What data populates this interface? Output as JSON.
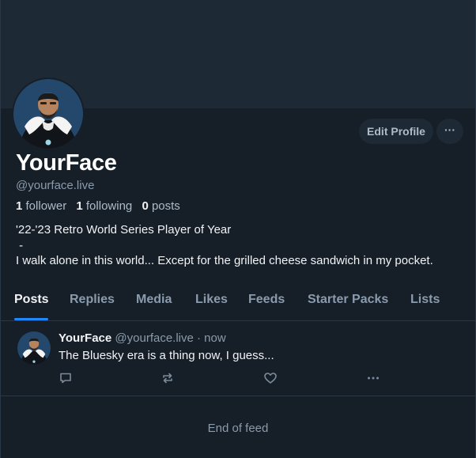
{
  "profile": {
    "display_name": "YourFace",
    "handle": "@yourface.live",
    "followers_count": "1",
    "followers_label": "follower",
    "following_count": "1",
    "following_label": "following",
    "posts_count": "0",
    "posts_label": "posts",
    "bio_line1": "'22-'23 Retro World Series Player of Year",
    "bio_line2": " -",
    "bio_line3": "I walk alone in this world... Except for the grilled cheese sandwich in my pocket."
  },
  "actions": {
    "edit_profile": "Edit Profile",
    "more": "···"
  },
  "tabs": [
    {
      "label": "Posts",
      "active": true
    },
    {
      "label": "Replies",
      "active": false
    },
    {
      "label": "Media",
      "active": false
    },
    {
      "label": "Likes",
      "active": false
    },
    {
      "label": "Feeds",
      "active": false
    },
    {
      "label": "Starter Packs",
      "active": false
    },
    {
      "label": "Lists",
      "active": false
    }
  ],
  "post": {
    "author": "YourFace",
    "meta": "@yourface.live · now",
    "text": "The Bluesky era is a thing now, I guess...",
    "icons": [
      "reply-icon",
      "repost-icon",
      "like-icon",
      "more-icon"
    ]
  },
  "feed_end": "End of feed",
  "colors": {
    "background": "#161e27",
    "banner": "#1e2936",
    "accent": "#2187ff",
    "muted": "#8a9bad"
  }
}
